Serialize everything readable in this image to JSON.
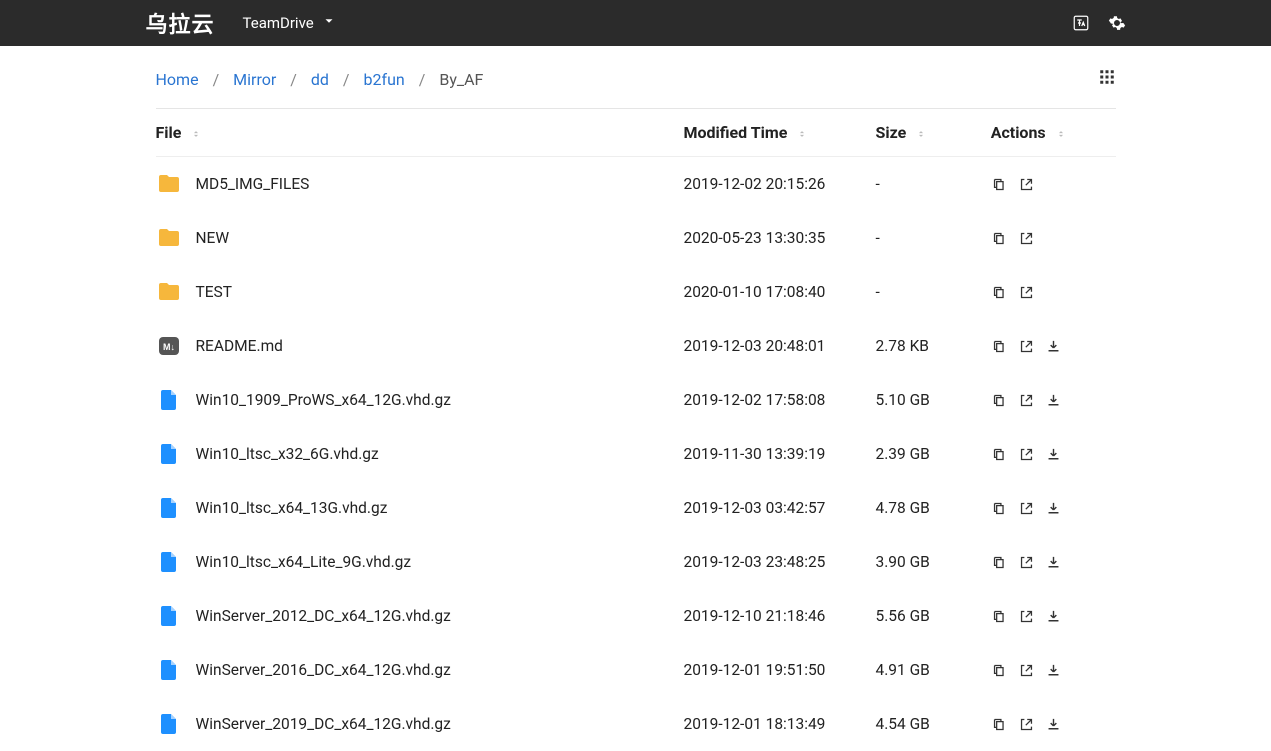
{
  "brand": "乌拉云",
  "team_dropdown": "TeamDrive",
  "breadcrumbs": {
    "items": [
      "Home",
      "Mirror",
      "dd",
      "b2fun",
      "By_AF"
    ]
  },
  "columns": {
    "file": "File",
    "modified": "Modified Time",
    "size": "Size",
    "actions": "Actions"
  },
  "rows": [
    {
      "type": "folder",
      "name": "MD5_IMG_FILES",
      "modified": "2019-12-02 20:15:26",
      "size": "-",
      "download": false
    },
    {
      "type": "folder",
      "name": "NEW",
      "modified": "2020-05-23 13:30:35",
      "size": "-",
      "download": false
    },
    {
      "type": "folder",
      "name": "TEST",
      "modified": "2020-01-10 17:08:40",
      "size": "-",
      "download": false
    },
    {
      "type": "md",
      "name": "README.md",
      "modified": "2019-12-03 20:48:01",
      "size": "2.78 KB",
      "download": true
    },
    {
      "type": "file",
      "name": "Win10_1909_ProWS_x64_12G.vhd.gz",
      "modified": "2019-12-02 17:58:08",
      "size": "5.10 GB",
      "download": true
    },
    {
      "type": "file",
      "name": "Win10_ltsc_x32_6G.vhd.gz",
      "modified": "2019-11-30 13:39:19",
      "size": "2.39 GB",
      "download": true
    },
    {
      "type": "file",
      "name": "Win10_ltsc_x64_13G.vhd.gz",
      "modified": "2019-12-03 03:42:57",
      "size": "4.78 GB",
      "download": true
    },
    {
      "type": "file",
      "name": "Win10_ltsc_x64_Lite_9G.vhd.gz",
      "modified": "2019-12-03 23:48:25",
      "size": "3.90 GB",
      "download": true
    },
    {
      "type": "file",
      "name": "WinServer_2012_DC_x64_12G.vhd.gz",
      "modified": "2019-12-10 21:18:46",
      "size": "5.56 GB",
      "download": true
    },
    {
      "type": "file",
      "name": "WinServer_2016_DC_x64_12G.vhd.gz",
      "modified": "2019-12-01 19:51:50",
      "size": "4.91 GB",
      "download": true
    },
    {
      "type": "file",
      "name": "WinServer_2019_DC_x64_12G.vhd.gz",
      "modified": "2019-12-01 18:13:49",
      "size": "4.54 GB",
      "download": true
    }
  ]
}
